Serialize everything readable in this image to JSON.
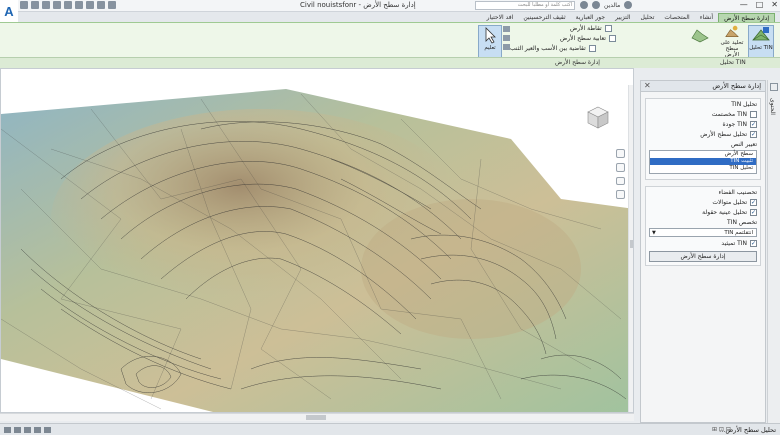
{
  "window": {
    "title": "إدارة سطح الأرض - Civil nouistsfonr",
    "search_placeholder": "اكتب كلمة أو مطلبا للبحث",
    "user_label": "مالدين",
    "controls": [
      "—",
      "□",
      "✕"
    ]
  },
  "ribbon": {
    "tabs": [
      "إدارة سطح الأرض",
      "أنشاء",
      "المتحصات",
      "تحليل",
      "التزيير",
      "جور العبارية",
      "ثقيف الترحسينين",
      "افد الاحتيار"
    ],
    "active_tab": "إدارة سطح الأرض",
    "buttons": {
      "tin_analysis": "تحليل TIN",
      "surface_edit": "تحليد على سطح الأرض",
      "select": "تعليم"
    },
    "small_items": [
      "تقاطة الأرض",
      "تعابية سطح الأرض",
      "تقاضية بين الأسب والعير الثنب"
    ],
    "panel_labels": {
      "left": "إدارة سطح الأرض",
      "right": "تحليل TIN"
    }
  },
  "side_panel": {
    "title": "إدارة سطح الأرض",
    "close": "✕",
    "section1": {
      "title": "تحليل TIN",
      "checks": [
        {
          "label": "مخصتمت TIN",
          "checked": false
        },
        {
          "label": "جودة TIN",
          "checked": true
        },
        {
          "label": "تحليل سطح الأرض",
          "checked": true
        }
      ],
      "list_label": "تعيير النص",
      "list_items": [
        "سطح الأرض",
        "تثبيت TIN",
        "تحليل TIN"
      ],
      "selected_index": 1
    },
    "section2": {
      "title": "تحصنيب الفضاء",
      "checks": [
        {
          "label": "تحليل متوالات",
          "checked": true
        },
        {
          "label": "تحليل عينية حقولة",
          "checked": true
        }
      ],
      "select_label": "تخصص TIN",
      "select_value": "انتقلتمم TIN",
      "check_last": {
        "label": "تميثيد TIN",
        "checked": true
      },
      "button": "إدارة سطح الأرض"
    }
  },
  "vertical_tab": "الحتوى",
  "status": {
    "text": "تحليل سطح الأرض...",
    "coords": "⊞ ⊡ ⊟"
  }
}
